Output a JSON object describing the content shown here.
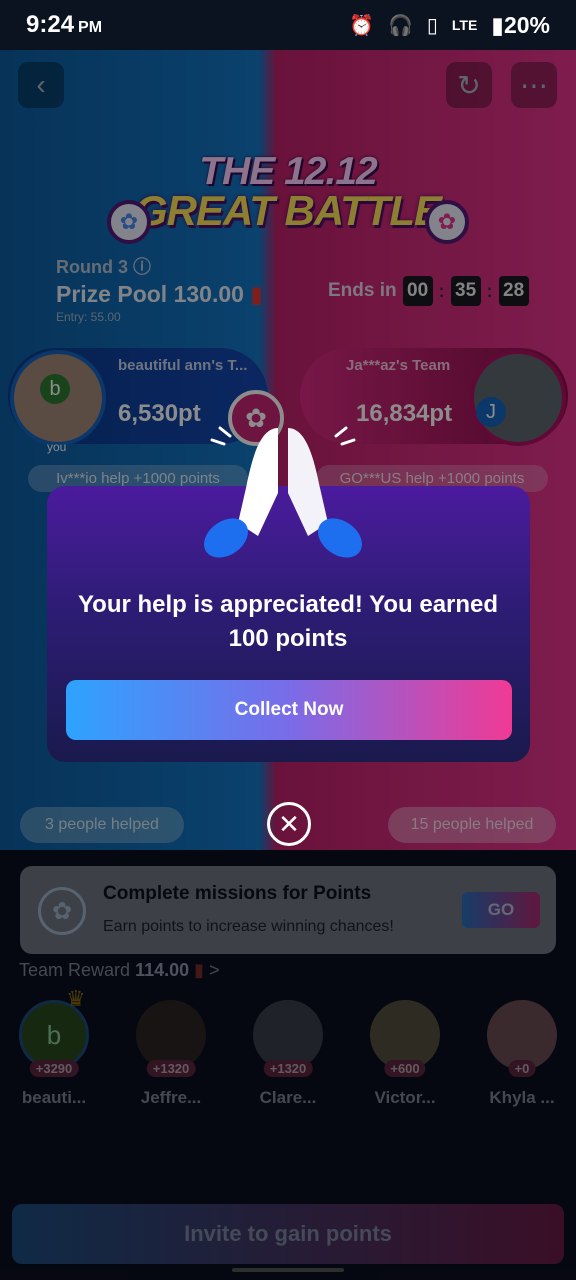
{
  "status": {
    "time": "9:24",
    "ampm": "PM",
    "icons": [
      "alarm-icon",
      "headphones-icon",
      "vibrate-icon",
      "signal-icon",
      "battery-icon"
    ],
    "network": "LTE",
    "battery": "20%"
  },
  "header": {
    "title_line1": "THE 12.12",
    "title_line2": "GREAT BATTLE"
  },
  "round": {
    "label": "Round 3",
    "prize_pool": "Prize Pool 130.00",
    "entry": "Entry: 55.00"
  },
  "timer": {
    "label": "Ends in",
    "hh": "00",
    "mm": "35",
    "ss": "28"
  },
  "team_left": {
    "name": "beautiful ann's T...",
    "points": "6,530pt",
    "avatar_letter": "b",
    "you_label": "you",
    "help_text": "Iv***io help +1000 points",
    "people_helped": "3 people helped"
  },
  "team_right": {
    "name": "Ja***az's Team",
    "points": "16,834pt",
    "avatar_letter": "J",
    "help_text": "GO***US help +1000 points",
    "people_helped": "15 people helped"
  },
  "mission": {
    "title": "Complete missions for Points",
    "subtitle": "Earn points to increase winning chances!",
    "go_label": "GO"
  },
  "team_reward": {
    "label": "Team Reward",
    "amount": "114.00",
    "chevron": ">"
  },
  "members": [
    {
      "letter": "b",
      "badge": "+3290",
      "name": "beauti..."
    },
    {
      "letter": "",
      "badge": "+1320",
      "name": "Jeffre..."
    },
    {
      "letter": "",
      "badge": "+1320",
      "name": "Clare..."
    },
    {
      "letter": "",
      "badge": "+600",
      "name": "Victor..."
    },
    {
      "letter": "",
      "badge": "+0",
      "name": "Khyla ..."
    }
  ],
  "invite": {
    "label": "Invite to gain points"
  },
  "modal": {
    "message": "Your help is appreciated! You earned 100 points",
    "collect_label": "Collect Now",
    "close_symbol": "✕"
  },
  "colors": {
    "team_blue": "#1478c8",
    "team_pink": "#e6358e",
    "modal_bg": "#3a1c86",
    "collect_start": "#2da3ff",
    "collect_end": "#f03a94"
  }
}
